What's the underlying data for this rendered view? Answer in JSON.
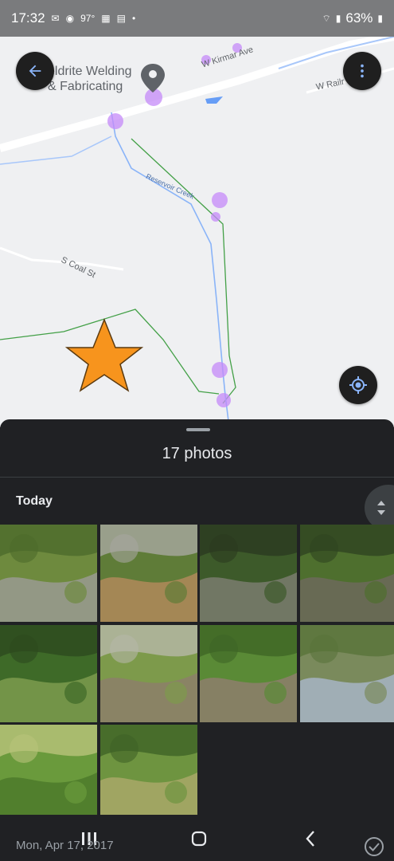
{
  "status_bar": {
    "time": "17:32",
    "temperature": "97°",
    "battery": "63%",
    "icons": [
      "gmail-icon",
      "chrome-icon",
      "calendar-icon",
      "news-icon",
      "dot-icon",
      "wifi-icon",
      "signal-icon",
      "battery-icon"
    ]
  },
  "map": {
    "poi_line1": "eldrite Welding",
    "poi_line2": "& Fabricating",
    "street_kirmar": "W Kirmar Ave",
    "street_rail": "W Railr",
    "creek": "Reservoir Creek",
    "street_coal": "S Coal St",
    "marker_color": "#f7941d",
    "photo_dot_color": "#c58af9"
  },
  "sheet": {
    "photo_count": "17 photos",
    "section_title": "Today",
    "date_label": "Mon, Apr 17, 2017"
  },
  "photos": [
    {
      "id": "1",
      "palette": [
        "#6e8a3e",
        "#9a9a92",
        "#4c6a2c"
      ]
    },
    {
      "id": "2",
      "palette": [
        "#5f7c38",
        "#b08a5a",
        "#a7a7a0"
      ]
    },
    {
      "id": "3",
      "palette": [
        "#3d5a2a",
        "#7a7d6e",
        "#2b3a20"
      ]
    },
    {
      "id": "4",
      "palette": [
        "#4e6f2e",
        "#6d6a5a",
        "#2f4420"
      ]
    },
    {
      "id": "5",
      "palette": [
        "#3e6a28",
        "#7c9b4e",
        "#2d4a1e"
      ]
    },
    {
      "id": "6",
      "palette": [
        "#7d9a4b",
        "#8c7f6a",
        "#b6b8a8"
      ]
    },
    {
      "id": "7",
      "palette": [
        "#5a8a36",
        "#8e7e6c",
        "#3e6526"
      ]
    },
    {
      "id": "8",
      "palette": [
        "#7a8a5c",
        "#a7b4c4",
        "#59733a"
      ]
    },
    {
      "id": "9",
      "palette": [
        "#6a9a3c",
        "#4c7a2a",
        "#b9c37a"
      ]
    },
    {
      "id": "10",
      "palette": [
        "#6e9440",
        "#a9a868",
        "#3f6326"
      ]
    }
  ],
  "nav": {
    "icons": [
      "recents-icon",
      "home-icon",
      "back-icon",
      "select-check-icon"
    ]
  }
}
